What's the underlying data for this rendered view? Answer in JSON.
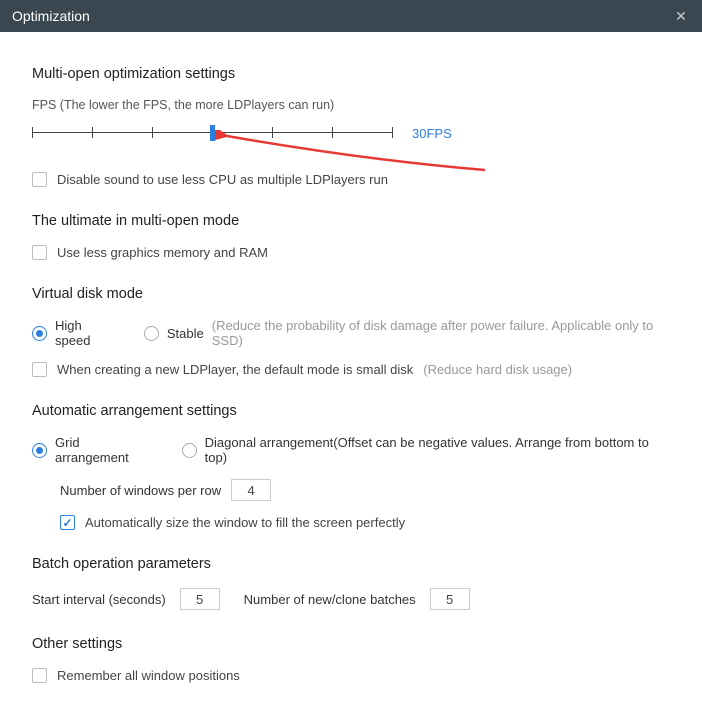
{
  "titlebar": {
    "title": "Optimization"
  },
  "multiOpen": {
    "title": "Multi-open optimization settings",
    "fpsLabel": "FPS (The lower the FPS, the more LDPlayers can run)",
    "fpsValue": "30FPS",
    "sliderPositionPercent": 50,
    "disableSound": "Disable sound to use less CPU as multiple LDPlayers run"
  },
  "ultimate": {
    "title": "The ultimate in multi-open mode",
    "lessMemory": "Use less graphics memory and RAM"
  },
  "virtualDisk": {
    "title": "Virtual disk mode",
    "highSpeed": "High speed",
    "stable": "Stable",
    "stableHint": "(Reduce the probability of disk damage after power failure. Applicable only to SSD)",
    "smallDisk": "When creating a new LDPlayer, the default mode is small disk",
    "smallDiskHint": "(Reduce hard disk usage)"
  },
  "arrangement": {
    "title": "Automatic arrangement settings",
    "grid": "Grid arrangement",
    "diagonal": "Diagonal arrangement(Offset can be negative values. Arrange from bottom to top)",
    "numWindowsLabel": "Number of windows per row",
    "numWindowsValue": "4",
    "autoSize": "Automatically size the window to fill the screen perfectly"
  },
  "batch": {
    "title": "Batch operation parameters",
    "startIntervalLabel": "Start interval (seconds)",
    "startIntervalValue": "5",
    "batchesLabel": "Number of new/clone batches",
    "batchesValue": "5"
  },
  "other": {
    "title": "Other settings",
    "rememberPositions": "Remember all window positions"
  }
}
